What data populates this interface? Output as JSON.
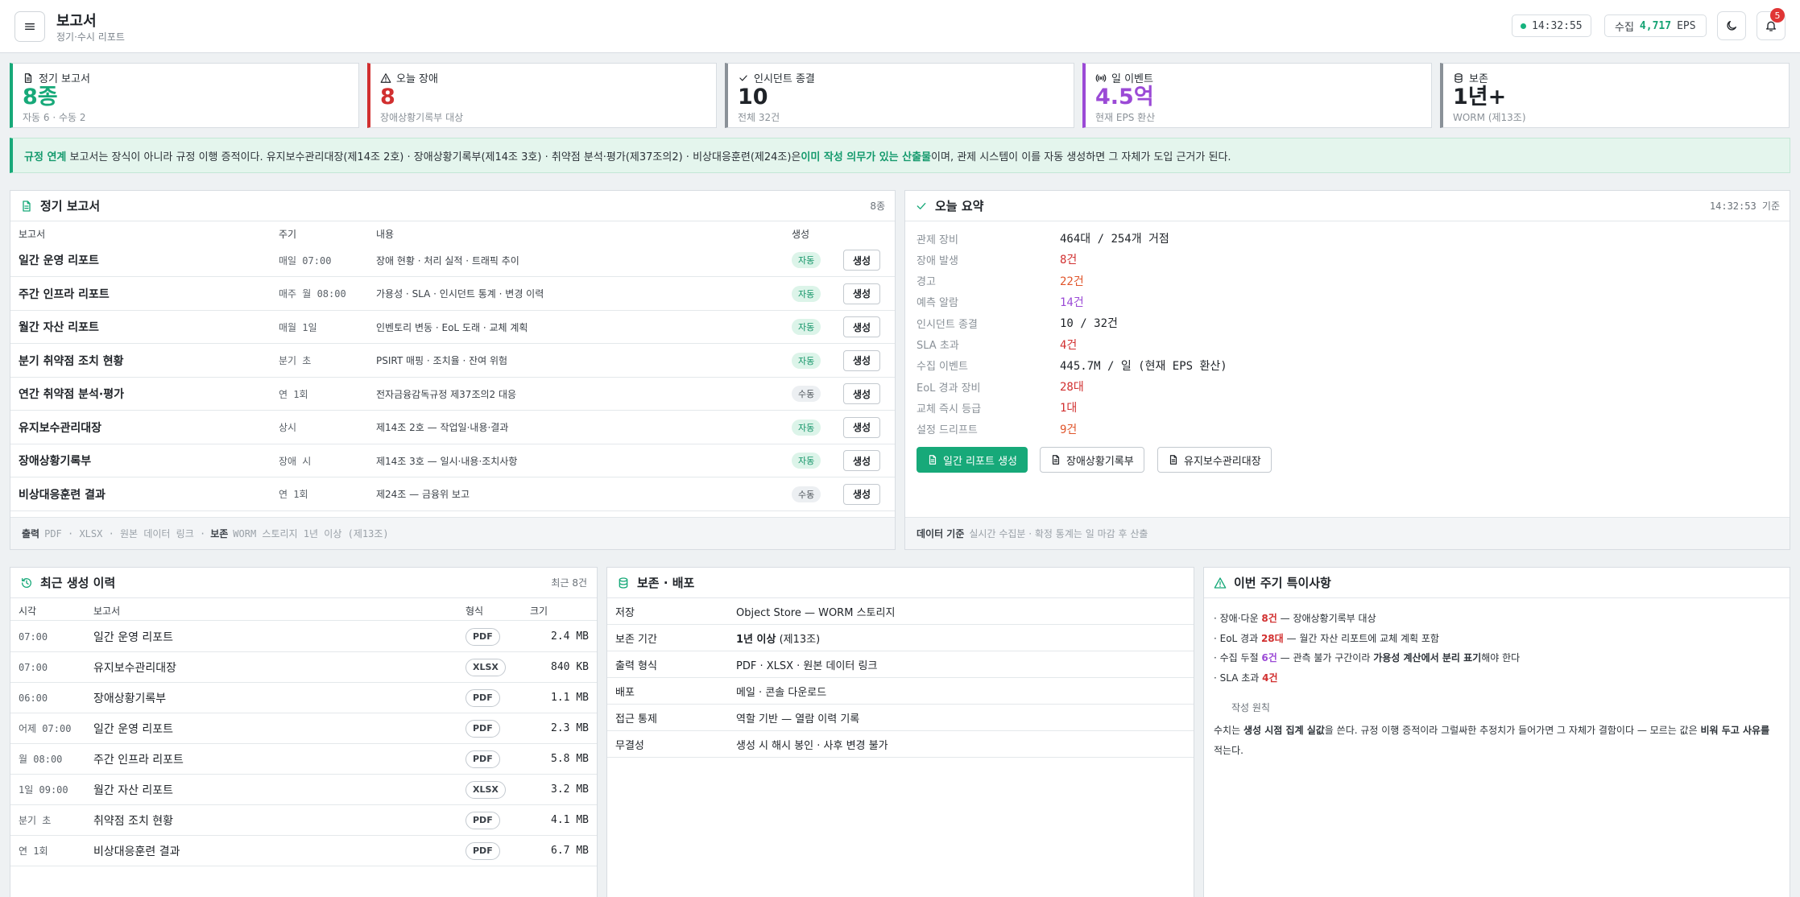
{
  "header": {
    "title": "보고서",
    "subtitle": "정기·수시 리포트",
    "clock": "14:32:55",
    "eps_label": "수집",
    "eps_value": "4,717",
    "eps_unit": "EPS",
    "notification_count": "5"
  },
  "stats": [
    {
      "label": "정기 보고서",
      "value": "8종",
      "sub": "자동 6 · 수동 2",
      "color": "#17a979",
      "icon": "document-icon"
    },
    {
      "label": "오늘 장애",
      "value": "8",
      "sub": "장애상황기록부 대상",
      "color": "#d12f2f",
      "icon": "warning-icon"
    },
    {
      "label": "인시던트 종결",
      "value": "10",
      "sub": "전체 32건",
      "color": "#1f2328",
      "icon": "check-icon"
    },
    {
      "label": "일 이벤트",
      "value": "4.5억",
      "sub": "현재 EPS 환산",
      "color": "#9b4ad6",
      "icon": "broadcast-icon"
    },
    {
      "label": "보존",
      "value": "1년+",
      "sub": "WORM (제13조)",
      "color": "#1f2328",
      "icon": "database-icon"
    }
  ],
  "banner": {
    "tag": "규정 연계",
    "text1": "보고서는 장식이 아니라 규정 이행 증적이다. 유지보수관리대장(제14조 2호) · 장애상황기록부(제14조 3호) · 취약점 분석·평가(제37조의2) · 비상대응훈련(제24조)은 ",
    "highlight": "이미 작성 의무가 있는 산출물",
    "text2": "이며, 관제 시스템이 이를 자동 생성하면 그 자체가 도입 근거가 된다."
  },
  "reports": {
    "title": "정기 보고서",
    "count": "8종",
    "columns": {
      "name": "보고서",
      "cycle": "주기",
      "content": "내용",
      "gen": "생성"
    },
    "generate_label": "생성",
    "rows": [
      {
        "name": "일간 운영 리포트",
        "cycle": "매일 07:00",
        "content": "장애 현황 · 처리 실적 · 트래픽 추이",
        "mode": "자동",
        "auto": true
      },
      {
        "name": "주간 인프라 리포트",
        "cycle": "매주 월 08:00",
        "content": "가용성 · SLA · 인시던트 통계 · 변경 이력",
        "mode": "자동",
        "auto": true
      },
      {
        "name": "월간 자산 리포트",
        "cycle": "매월 1일",
        "content": "인벤토리 변동 · EoL 도래 · 교체 계획",
        "mode": "자동",
        "auto": true
      },
      {
        "name": "분기 취약점 조치 현황",
        "cycle": "분기 초",
        "content": "PSIRT 매핑 · 조치율 · 잔여 위험",
        "mode": "자동",
        "auto": true
      },
      {
        "name": "연간 취약점 분석·평가",
        "cycle": "연 1회",
        "content": "전자금융감독규정 제37조의2 대응",
        "mode": "수동",
        "auto": false
      },
      {
        "name": "유지보수관리대장",
        "cycle": "상시",
        "content": "제14조 2호 — 작업일·내용·결과",
        "mode": "자동",
        "auto": true
      },
      {
        "name": "장애상황기록부",
        "cycle": "장애 시",
        "content": "제14조 3호 — 일시·내용·조치사항",
        "mode": "자동",
        "auto": true
      },
      {
        "name": "비상대응훈련 결과",
        "cycle": "연 1회",
        "content": "제24조 — 금융위 보고",
        "mode": "수동",
        "auto": false
      }
    ],
    "footer": {
      "out_label": "출력",
      "out_value": "PDF · XLSX · 원본 데이터 링크 ·",
      "keep_label": "보존",
      "keep_value": "WORM 스토리지 1년 이상 (제13조)"
    }
  },
  "summary": {
    "title": "오늘 요약",
    "asof": "14:32:53 기준",
    "rows": [
      {
        "key": "관제 장비",
        "value": "464대 / 254개 거점",
        "color": "#1f2328"
      },
      {
        "key": "장애 발생",
        "value": "8건",
        "color": "#d12f2f"
      },
      {
        "key": "경고",
        "value": "22건",
        "color": "#e0552b"
      },
      {
        "key": "예측 알람",
        "value": "14건",
        "color": "#9b4ad6"
      },
      {
        "key": "인시던트 종결",
        "value": "10 / 32건",
        "color": "#1f2328"
      },
      {
        "key": "SLA 초과",
        "value": "4건",
        "color": "#d12f2f"
      },
      {
        "key": "수집 이벤트",
        "value": "445.7M / 일 (현재 EPS 환산)",
        "color": "#1f2328"
      },
      {
        "key": "EoL 경과 장비",
        "value": "28대",
        "color": "#d12f2f"
      },
      {
        "key": "교체 즉시 등급",
        "value": "1대",
        "color": "#d12f2f"
      },
      {
        "key": "설정 드리프트",
        "value": "9건",
        "color": "#e0552b"
      }
    ],
    "buttons": {
      "daily": "일간 리포트 생성",
      "incident": "장애상황기록부",
      "maint": "유지보수관리대장"
    },
    "footer": {
      "label": "데이터 기준",
      "value": "실시간 수집분 · 확정 통계는 일 마감 후 산출"
    }
  },
  "history": {
    "title": "최근 생성 이력",
    "count": "최근 8건",
    "columns": {
      "time": "시각",
      "name": "보고서",
      "format": "형식",
      "size": "크기"
    },
    "rows": [
      {
        "time": "07:00",
        "name": "일간 운영 리포트",
        "format": "PDF",
        "size": "2.4 MB"
      },
      {
        "time": "07:00",
        "name": "유지보수관리대장",
        "format": "XLSX",
        "size": "840 KB"
      },
      {
        "time": "06:00",
        "name": "장애상황기록부",
        "format": "PDF",
        "size": "1.1 MB"
      },
      {
        "time": "어제 07:00",
        "name": "일간 운영 리포트",
        "format": "PDF",
        "size": "2.3 MB"
      },
      {
        "time": "월 08:00",
        "name": "주간 인프라 리포트",
        "format": "PDF",
        "size": "5.8 MB"
      },
      {
        "time": "1일 09:00",
        "name": "월간 자산 리포트",
        "format": "XLSX",
        "size": "3.2 MB"
      },
      {
        "time": "분기 초",
        "name": "취약점 조치 현황",
        "format": "PDF",
        "size": "4.1 MB"
      },
      {
        "time": "연 1회",
        "name": "비상대응훈련 결과",
        "format": "PDF",
        "size": "6.7 MB"
      }
    ]
  },
  "storage": {
    "title": "보존 · 배포",
    "rows": [
      {
        "key": "저장",
        "value": "Object Store — WORM 스토리지"
      },
      {
        "key": "보존 기간",
        "value_bold": "1년 이상",
        "value": " (제13조)"
      },
      {
        "key": "출력 형식",
        "value": "PDF · XLSX · 원본 데이터 링크"
      },
      {
        "key": "배포",
        "value": "메일 · 콘솔 다운로드"
      },
      {
        "key": "접근 통제",
        "value": "역할 기반 — 열람 이력 기록"
      },
      {
        "key": "무결성",
        "value": "생성 시 해시 봉인 · 사후 변경 불가"
      }
    ]
  },
  "notes": {
    "title": "이번 주기 특이사항",
    "items": [
      {
        "pre": "· 장애·다운 ",
        "hl": "8건",
        "post": " — 장애상황기록부 대상"
      },
      {
        "pre": "· EoL 경과 ",
        "hl": "28대",
        "post": " — 월간 자산 리포트에 교체 계획 포함"
      },
      {
        "pre": "· 수집 두절 ",
        "hl": "6건",
        "post": " — 관측 불가 구간이라 ",
        "bold": "가용성 계산에서 분리 표기",
        "post2": "해야 한다"
      },
      {
        "pre": "· SLA 초과 ",
        "hl": "4건",
        "post": ""
      }
    ],
    "principle_title": "작성 원칙",
    "principle": {
      "t1": "수치는 ",
      "b1": "생성 시점 집계 실값",
      "t2": "을 쓴다. 규정 이행 증적이라 그럴싸한 추정치가 들어가면 그 자체가 결함이다 — 모르는 값은 ",
      "b2": "비워 두고 사유를",
      "t3": "적는다."
    }
  }
}
